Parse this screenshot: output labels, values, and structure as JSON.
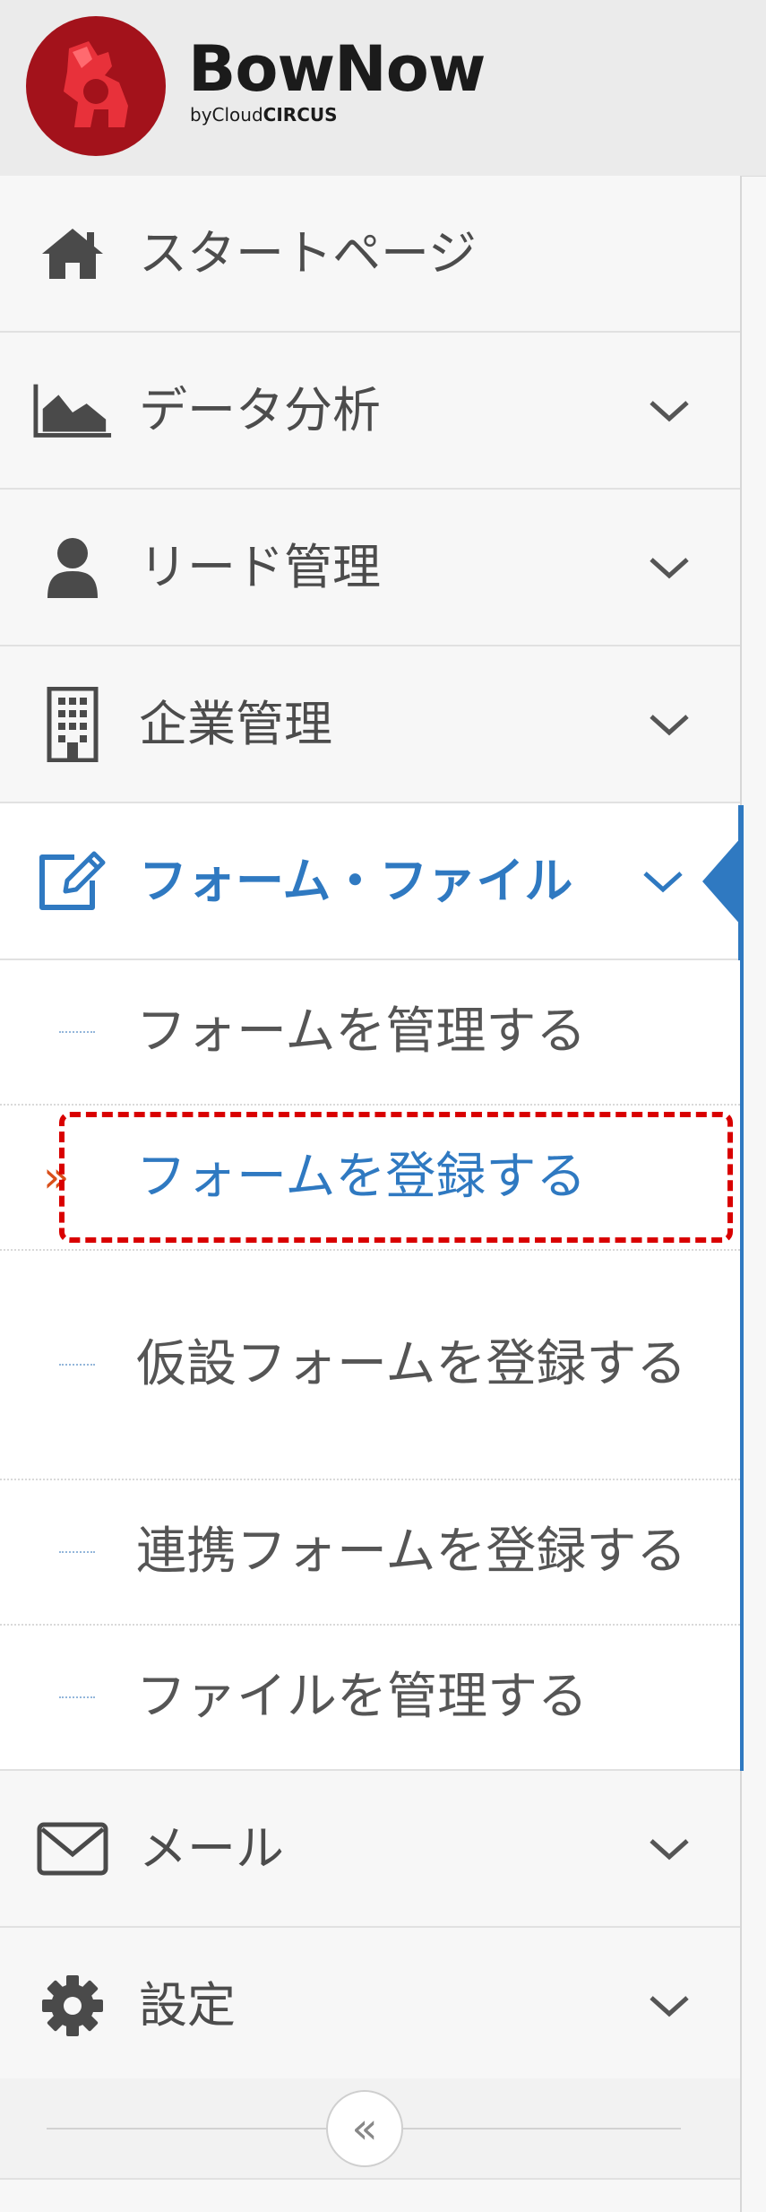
{
  "brand": {
    "name": "BowNow",
    "by_prefix": "by",
    "by_cloud": "Cloud",
    "by_circus": "CIRCUS"
  },
  "menu": [
    {
      "label": "スタートページ",
      "icon": "home-icon"
    },
    {
      "label": "データ分析",
      "icon": "area-chart-icon"
    },
    {
      "label": "リード管理",
      "icon": "user-icon"
    },
    {
      "label": "企業管理",
      "icon": "building-icon"
    },
    {
      "label": "フォーム・ファイル",
      "icon": "edit-icon",
      "active": true
    },
    {
      "label": "メール",
      "icon": "envelope-icon"
    },
    {
      "label": "設定",
      "icon": "gear-icon"
    }
  ],
  "submenu": [
    {
      "label": "フォームを管理する"
    },
    {
      "label": "フォームを登録する",
      "selected": true
    },
    {
      "label": "仮設フォームを登録する"
    },
    {
      "label": "連携フォームを登録する"
    },
    {
      "label": "ファイルを管理する"
    }
  ],
  "selected_marker": "»",
  "collapse_symbol": "«",
  "colors": {
    "accent": "#2f79c1",
    "brand_red": "#a3121b",
    "highlight": "#d90000",
    "arrow": "#d94f1a"
  }
}
